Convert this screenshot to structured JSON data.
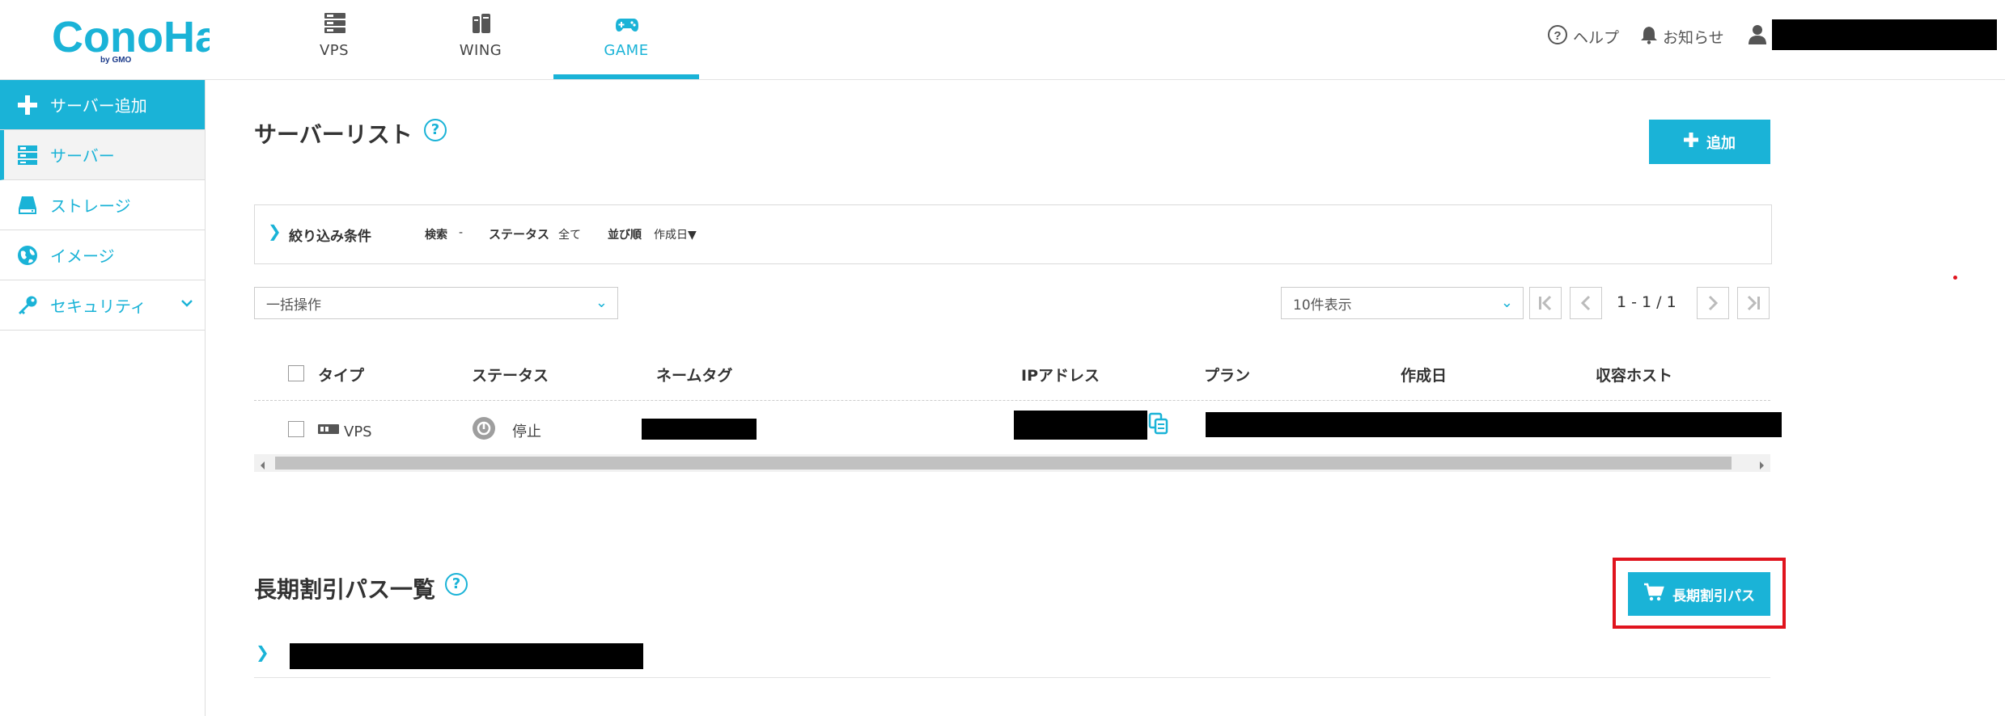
{
  "header": {
    "logo": "ConoHa by GMO",
    "logo_main": "ConoHa",
    "logo_sub": "by GMO",
    "tabs": [
      {
        "label": "VPS",
        "icon": "server-stack-icon",
        "active": false
      },
      {
        "label": "WING",
        "icon": "wing-icon",
        "active": false
      },
      {
        "label": "GAME",
        "icon": "gamepad-icon",
        "active": true
      }
    ],
    "help_label": "ヘルプ",
    "notice_label": "お知らせ"
  },
  "sidebar": {
    "items": [
      {
        "label": "サーバー追加",
        "icon": "plus-icon"
      },
      {
        "label": "サーバー",
        "icon": "server-icon"
      },
      {
        "label": "ストレージ",
        "icon": "storage-icon"
      },
      {
        "label": "イメージ",
        "icon": "globe-icon"
      },
      {
        "label": "セキュリティ",
        "icon": "key-icon"
      }
    ]
  },
  "server_list": {
    "title": "サーバーリスト",
    "help": "?",
    "add_button": "追加",
    "filter": {
      "toggle": "❯",
      "title": "絞り込み条件",
      "search_label": "検索",
      "search_value": "-",
      "status_label": "ステータス",
      "status_value": "全て",
      "sort_label": "並び順",
      "sort_value": "作成日▼"
    },
    "bulk_select": "一括操作",
    "page_size": "10件表示",
    "pagination": "1 - 1 / 1",
    "columns": [
      "タイプ",
      "ステータス",
      "ネームタグ",
      "IPアドレス",
      "プラン",
      "作成日",
      "収容ホスト"
    ],
    "rows": [
      {
        "type": "VPS",
        "status": "停止"
      }
    ]
  },
  "discount": {
    "title": "長期割引パス一覧",
    "help": "?",
    "button": "長期割引パス",
    "toggle": "❯"
  },
  "colors": {
    "accent": "#1ab3d7",
    "highlight": "#e0141e"
  }
}
